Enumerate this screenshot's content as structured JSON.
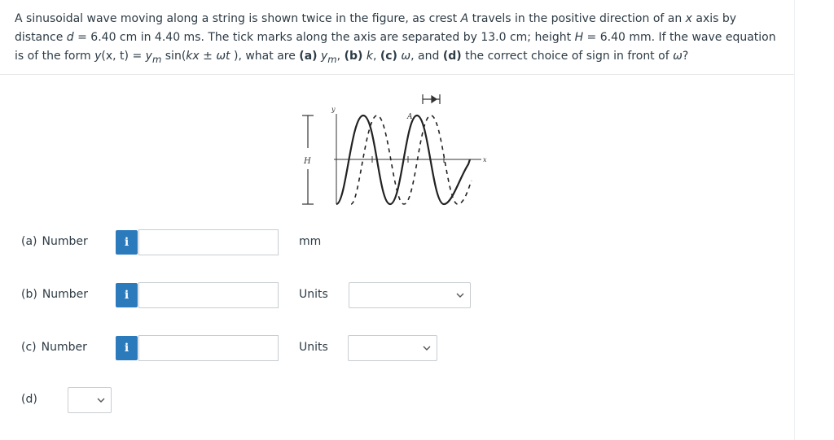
{
  "question": {
    "sentence1": "A sinusoidal wave moving along a string is shown twice in the figure, as crest ",
    "crest": "A",
    "sentence2": " travels in the positive direction of an ",
    "axis_var": "x",
    "sentence3": " axis by distance ",
    "d_var": "d",
    "d_value": " = 6.40 cm in 4.40 ms. The tick marks along the axis are separated by 13.0 cm; height ",
    "H_var": "H",
    "H_value": " = 6.40 mm. If the wave equation is of the form ",
    "eq_y": "y",
    "eq_args": "(x, t)",
    "eq_mid": " = ",
    "eq_ym": "y",
    "eq_ym_sub": "m",
    "eq_sin": " sin(",
    "eq_kx": "kx",
    "eq_pm": " ± ",
    "eq_wt": "ωt",
    "eq_close": " ), what are ",
    "part_a": "(a)",
    "part_a_sym": "y",
    "part_a_sub": "m",
    "comma1": ", ",
    "part_b": "(b)",
    "part_b_sym": " k",
    "comma2": ", ",
    "part_c": "(c)",
    "part_c_sym": " ω",
    "and_text": ", and ",
    "part_d": "(d)",
    "ending": " the correct choice of sign in front of ",
    "omega": "ω",
    "qmark": "?"
  },
  "figure": {
    "label_y": "y",
    "label_A": "A",
    "label_H": "H",
    "label_x": "x"
  },
  "answers": [
    {
      "part": "(a)",
      "label": "Number",
      "info": "i",
      "value": "",
      "unit_text": "mm"
    },
    {
      "part": "(b)",
      "label": "Number",
      "info": "i",
      "value": "",
      "unit_text": "Units",
      "unit_select": ""
    },
    {
      "part": "(c)",
      "label": "Number",
      "info": "i",
      "value": "",
      "unit_text": "Units",
      "unit_select": ""
    },
    {
      "part": "(d)",
      "select": ""
    }
  ],
  "colors": {
    "text": "#2d3b45",
    "info_button": "#2b7abc",
    "input_border": "#c7cdd1"
  }
}
